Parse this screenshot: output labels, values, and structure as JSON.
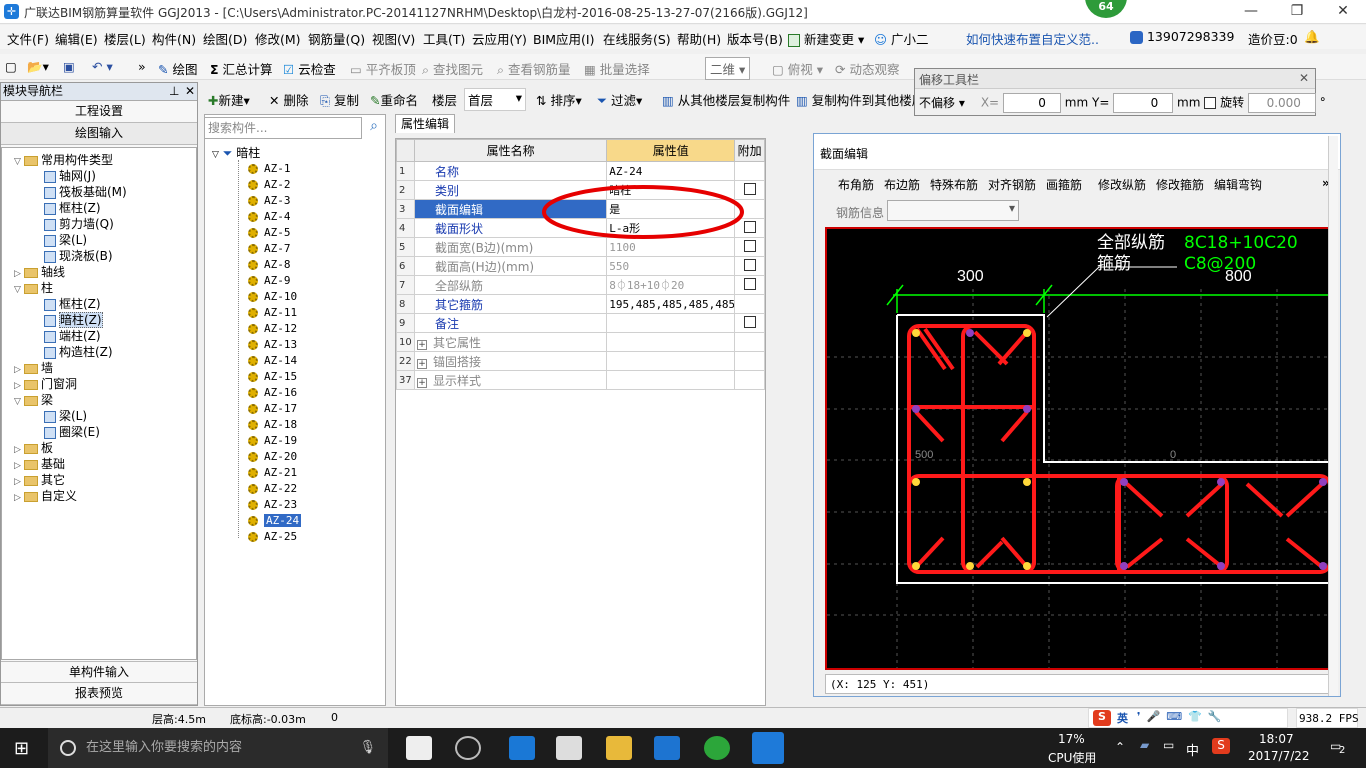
{
  "app": {
    "title": "广联达BIM钢筋算量软件 GGJ2013 - [C:\\Users\\Administrator.PC-20141127NRHM\\Desktop\\白龙村-2016-08-25-13-27-07(2166版).GGJ12]",
    "badge": "64"
  },
  "menu": [
    "文件(F)",
    "编辑(E)",
    "楼层(L)",
    "构件(N)",
    "绘图(D)",
    "修改(M)",
    "钢筋量(Q)",
    "视图(V)",
    "工具(T)",
    "云应用(Y)",
    "BIM应用(I)",
    "在线服务(S)",
    "帮助(H)",
    "版本号(B)",
    "新建变更",
    "广小二",
    "如何快速布置自定义范..",
    "13907298339",
    "造价豆:0"
  ],
  "toolbar": [
    "绘图",
    "汇总计算",
    "云检查",
    "平齐板顶",
    "查找图元",
    "查看钢筋量",
    "批量选择",
    "二维",
    "俯视",
    "动态观察"
  ],
  "toolbar2": [
    "新建",
    "删除",
    "复制",
    "重命名",
    "楼层",
    "首层",
    "排序",
    "过滤",
    "从其他楼层复制构件",
    "复制构件到其他楼层"
  ],
  "nav": {
    "header": "模块导航栏",
    "pin": "ꟼ",
    "top_buttons": [
      "工程设置",
      "绘图输入"
    ],
    "bottom_buttons": [
      "单构件输入",
      "报表预览"
    ],
    "tree": [
      {
        "level": 0,
        "exp": "▽",
        "folder": true,
        "label": "常用构件类型"
      },
      {
        "level": 1,
        "label": "轴网(J)"
      },
      {
        "level": 1,
        "label": "筏板基础(M)"
      },
      {
        "level": 1,
        "label": "框柱(Z)"
      },
      {
        "level": 1,
        "label": "剪力墙(Q)"
      },
      {
        "level": 1,
        "label": "梁(L)"
      },
      {
        "level": 1,
        "label": "现浇板(B)"
      },
      {
        "level": 0,
        "exp": "▷",
        "folder": true,
        "label": "轴线"
      },
      {
        "level": 0,
        "exp": "▽",
        "folder": true,
        "label": "柱"
      },
      {
        "level": 1,
        "label": "框柱(Z)"
      },
      {
        "level": 1,
        "label": "暗柱(Z)",
        "sel": true
      },
      {
        "level": 1,
        "label": "端柱(Z)"
      },
      {
        "level": 1,
        "label": "构造柱(Z)"
      },
      {
        "level": 0,
        "exp": "▷",
        "folder": true,
        "label": "墙"
      },
      {
        "level": 0,
        "exp": "▷",
        "folder": true,
        "label": "门窗洞"
      },
      {
        "level": 0,
        "exp": "▽",
        "folder": true,
        "label": "梁"
      },
      {
        "level": 1,
        "label": "梁(L)"
      },
      {
        "level": 1,
        "label": "圈梁(E)"
      },
      {
        "level": 0,
        "exp": "▷",
        "folder": true,
        "label": "板"
      },
      {
        "level": 0,
        "exp": "▷",
        "folder": true,
        "label": "基础"
      },
      {
        "level": 0,
        "exp": "▷",
        "folder": true,
        "label": "其它"
      },
      {
        "level": 0,
        "exp": "▷",
        "folder": true,
        "label": "自定义"
      }
    ]
  },
  "complist": {
    "search_placeholder": "搜索构件...",
    "root": "暗柱",
    "items": [
      "AZ-1",
      "AZ-2",
      "AZ-3",
      "AZ-4",
      "AZ-5",
      "AZ-7",
      "AZ-8",
      "AZ-9",
      "AZ-10",
      "AZ-11",
      "AZ-12",
      "AZ-13",
      "AZ-14",
      "AZ-15",
      "AZ-16",
      "AZ-17",
      "AZ-18",
      "AZ-19",
      "AZ-20",
      "AZ-21",
      "AZ-22",
      "AZ-23",
      "AZ-24",
      "AZ-25"
    ],
    "selected": "AZ-24"
  },
  "props": {
    "tab": "属性编辑",
    "headers": [
      "属性名称",
      "属性值",
      "附加"
    ],
    "rows": [
      {
        "n": "1",
        "name": "名称",
        "val": "AZ-24",
        "cb": false,
        "gray": false
      },
      {
        "n": "2",
        "name": "类别",
        "val": "暗柱",
        "cb": true,
        "gray": false
      },
      {
        "n": "3",
        "name": "截面编辑",
        "val": "是",
        "cb": false,
        "gray": false,
        "sel": true
      },
      {
        "n": "4",
        "name": "截面形状",
        "val": "L-a形",
        "cb": true,
        "gray": false
      },
      {
        "n": "5",
        "name": "截面宽(B边)(mm)",
        "val": "1100",
        "cb": true,
        "gray": true
      },
      {
        "n": "6",
        "name": "截面高(H边)(mm)",
        "val": "550",
        "cb": true,
        "gray": true
      },
      {
        "n": "7",
        "name": "全部纵筋",
        "val": "8⏀18+10⏀20",
        "cb": true,
        "gray": true
      },
      {
        "n": "8",
        "name": "其它箍筋",
        "val": "195,485,485,485,485,",
        "cb": false,
        "gray": false
      },
      {
        "n": "9",
        "name": "备注",
        "val": "",
        "cb": true,
        "gray": false
      },
      {
        "n": "10",
        "name": "其它属性",
        "val": "",
        "cb": false,
        "gray": true,
        "plus": true
      },
      {
        "n": "22",
        "name": "锚固搭接",
        "val": "",
        "cb": false,
        "gray": true,
        "plus": true
      },
      {
        "n": "37",
        "name": "显示样式",
        "val": "",
        "cb": false,
        "gray": true,
        "plus": true
      }
    ]
  },
  "offset": {
    "title": "偏移工具栏",
    "mode": "不偏移",
    "x_label": "X=",
    "x": "0",
    "y_label": "Y=",
    "y": "0",
    "unit": "mm",
    "rotate_label": "旋转",
    "rotate": "0.000",
    "deg": "°"
  },
  "section": {
    "title": "截面编辑",
    "tools": [
      "布角筋",
      "布边筋",
      "特殊布筋",
      "对齐钢筋",
      "画箍筋",
      "修改纵筋",
      "修改箍筋",
      "编辑弯钩"
    ],
    "rebar_info_label": "钢筋信息",
    "label_all": "全部纵筋",
    "label_all_val": "8C18+10C20",
    "label_stirrup": "箍筋",
    "label_stirrup_val": "C8@200",
    "dim1": "300",
    "dim2": "800",
    "dim3": "500",
    "dim4": "0",
    "coords": "(X: 125 Y: 451)"
  },
  "status": {
    "floor_height": "层高:4.5m",
    "base_elev": "底标高:-0.03m",
    "zero": "0",
    "fps": "938.2 FPS",
    "ime": "英"
  },
  "taskbar": {
    "search": "在这里输入你要搜索的内容",
    "cpu": "17%",
    "cpu_label": "CPU使用",
    "lang": "中",
    "time": "18:07",
    "date": "2017/7/22",
    "notif": "2"
  },
  "colors": {
    "rebar": "#ff1a1a",
    "dim": "#00ff00",
    "outline": "#ffffff",
    "select": "#316ac5",
    "annotation": "#e60000"
  }
}
